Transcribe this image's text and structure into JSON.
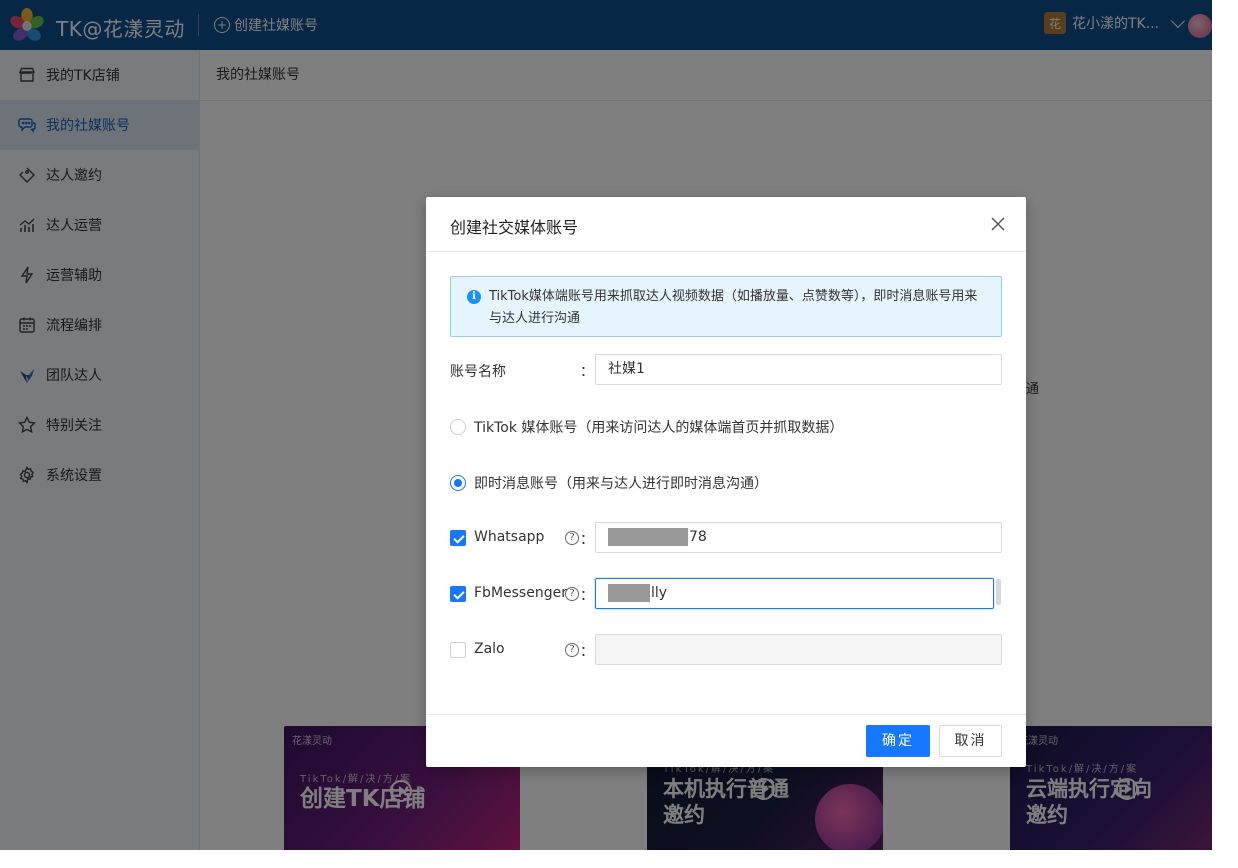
{
  "topbar": {
    "brand": "TK@花漾灵动",
    "create_link": "创建社媒账号",
    "user_name": "花小漾的TK...",
    "user_avatar_char": "花"
  },
  "sidebar": {
    "items": [
      {
        "label": "我的TK店铺",
        "icon": "store-icon"
      },
      {
        "label": "我的社媒账号",
        "icon": "chat-icon",
        "active": true
      },
      {
        "label": "达人邀约",
        "icon": "tag-icon"
      },
      {
        "label": "达人运营",
        "icon": "bar-chart-icon"
      },
      {
        "label": "运营辅助",
        "icon": "lightning-icon"
      },
      {
        "label": "流程编排",
        "icon": "calendar-icon"
      },
      {
        "label": "团队达人",
        "icon": "people-icon"
      },
      {
        "label": "特别关注",
        "icon": "star-icon"
      },
      {
        "label": "系统设置",
        "icon": "gear-icon"
      }
    ]
  },
  "main": {
    "breadcrumb": "我的社媒账号",
    "stray_char": "通",
    "banners": [
      {
        "brand": "花漾灵动",
        "sub": "TikTok/解/决/方/案",
        "title": "创建TK店铺"
      },
      {
        "brand": "",
        "sub": "TikTok/解/决/方/案",
        "title": "本机执行普通\n邀约"
      },
      {
        "brand": "花漾灵动",
        "sub": "TikTok/解/决/方/案",
        "title": "云端执行定向\n邀约"
      }
    ]
  },
  "modal": {
    "title": "创建社交媒体账号",
    "alert": "TikTok媒体端账号用来抓取达人视频数据（如播放量、点赞数等），即时消息账号用来与达人进行沟通",
    "name_label": "账号名称",
    "name_value": "社媒1",
    "colon": "：",
    "radio_tiktok": "TikTok 媒体账号（用来访问达人的媒体端首页并抓取数据）",
    "radio_im": "即时消息账号（用来与达人进行即时消息沟通）",
    "selected_radio": "im",
    "channels": [
      {
        "label": "Whatsapp",
        "checked": true,
        "visible_suffix": "78"
      },
      {
        "label": "FbMessenger",
        "checked": true,
        "visible_suffix": "lly"
      },
      {
        "label": "Zalo",
        "checked": false,
        "visible_suffix": ""
      }
    ],
    "help_glyph": "?",
    "ok_label": "确定",
    "cancel_label": "取消"
  }
}
